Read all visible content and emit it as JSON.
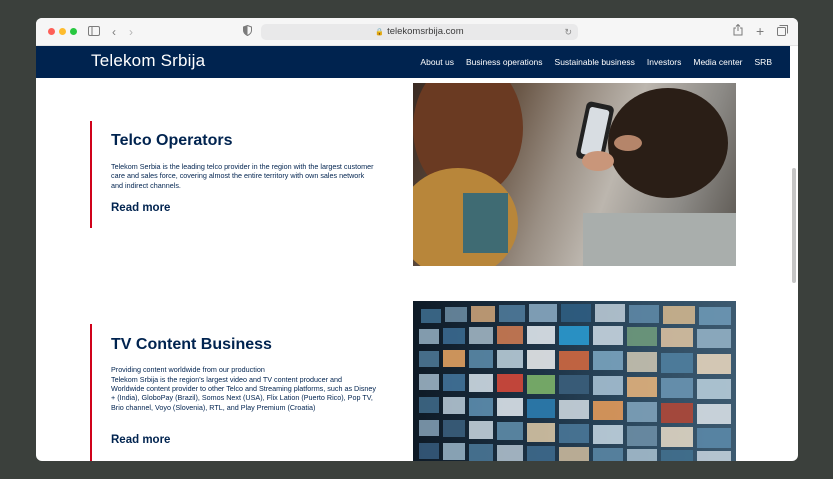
{
  "browser": {
    "url": "telekomsrbija.com"
  },
  "site": {
    "brand": "Telekom Srbija",
    "nav": [
      "About us",
      "Business operations",
      "Sustainable business",
      "Investors",
      "Media center",
      "SRB"
    ]
  },
  "sections": [
    {
      "title": "Telco Operators",
      "description": "Telekom Serbia is the leading telco provider in the region with the largest customer care and sales force, covering almost the entire territory with own sales network and indirect channels.",
      "link": "Read more"
    },
    {
      "title": "TV Content Business",
      "subtitle": "Providing content worldwide from our production",
      "description": "Telekom Srbija is the region's largest video and TV content producer and Worldwide content provider to other Telco and Streaming platforms, such as Disney + (India), GloboPay (Brazil), Somos Next (USA), Flix Lation (Puerto Rico), Pop TV, Brio channel, Voyo (Slovenia), RTL, and Play Premium (Croatia)",
      "link": "Read more"
    }
  ],
  "colors": {
    "navy": "#00234f",
    "accent_red": "#d0021b"
  }
}
